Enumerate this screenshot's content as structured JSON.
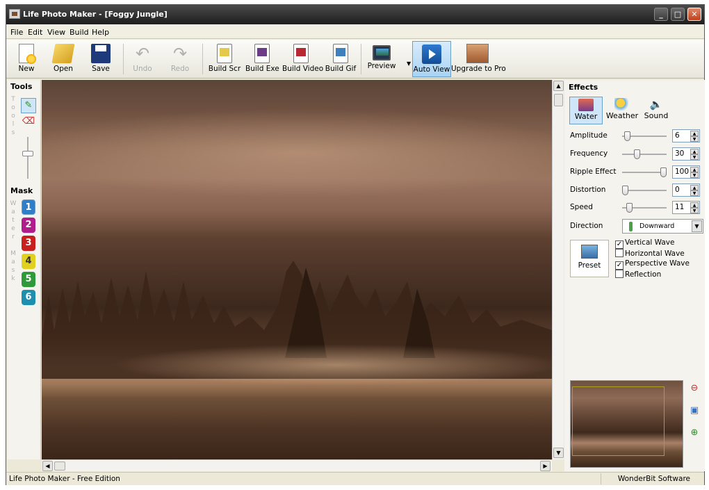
{
  "window": {
    "title": "Life Photo Maker - [Foggy Jungle]"
  },
  "menu": [
    "File",
    "Edit",
    "View",
    "Build",
    "Help"
  ],
  "toolbar": {
    "new": "New",
    "open": "Open",
    "save": "Save",
    "undo": "Undo",
    "redo": "Redo",
    "build_scr": "Build Scr",
    "build_exe": "Build Exe",
    "build_video": "Build Video",
    "build_gif": "Build Gif",
    "preview": "Preview",
    "auto_view": "Auto View",
    "upgrade": "Upgrade to Pro"
  },
  "tools": {
    "title": "Tools",
    "side_tab": "Tools"
  },
  "mask": {
    "title": "Mask",
    "side_tab": "Water Mask",
    "items": [
      "1",
      "2",
      "3",
      "4",
      "5",
      "6"
    ]
  },
  "effects": {
    "title": "Effects",
    "tabs": [
      "Water",
      "Weather",
      "Sound"
    ],
    "params": [
      {
        "label": "Amplitude",
        "value": "6",
        "level": 0.05
      },
      {
        "label": "Frequency",
        "value": "30",
        "level": 0.3
      },
      {
        "label": "Ripple Effect",
        "value": "100",
        "level": 1.0
      },
      {
        "label": "Distortion",
        "value": "0",
        "level": 0.0
      },
      {
        "label": "Speed",
        "value": "11",
        "level": 0.1
      }
    ],
    "direction_label": "Direction",
    "direction_value": "Downward",
    "preset": "Preset",
    "options": [
      {
        "label": "Vertical Wave",
        "checked": true
      },
      {
        "label": "Horizontal Wave",
        "checked": false
      },
      {
        "label": "Perspective Wave",
        "checked": true
      },
      {
        "label": "Reflection",
        "checked": false
      }
    ]
  },
  "status": {
    "left": "Life Photo Maker - Free Edition",
    "right": "WonderBit Software"
  },
  "colors": {
    "selected_tab_bg": "#cfe6f8",
    "selected_tab_border": "#6b9fc8",
    "mask_colors": [
      "#2f7fc8",
      "#b01e8c",
      "#c8201e",
      "#e0d020",
      "#2e9a3a",
      "#1f8fb0"
    ]
  },
  "icons": {
    "new": "new-document-icon",
    "open": "open-folder-icon",
    "save": "floppy-disk-icon",
    "undo": "undo-arrow-icon",
    "redo": "redo-arrow-icon",
    "build_scr": "screensaver-icon",
    "build_exe": "exe-icon",
    "build_video": "video-icon",
    "build_gif": "gif-icon",
    "preview": "monitor-icon",
    "auto_view": "play-icon",
    "upgrade": "upgrade-icon"
  }
}
